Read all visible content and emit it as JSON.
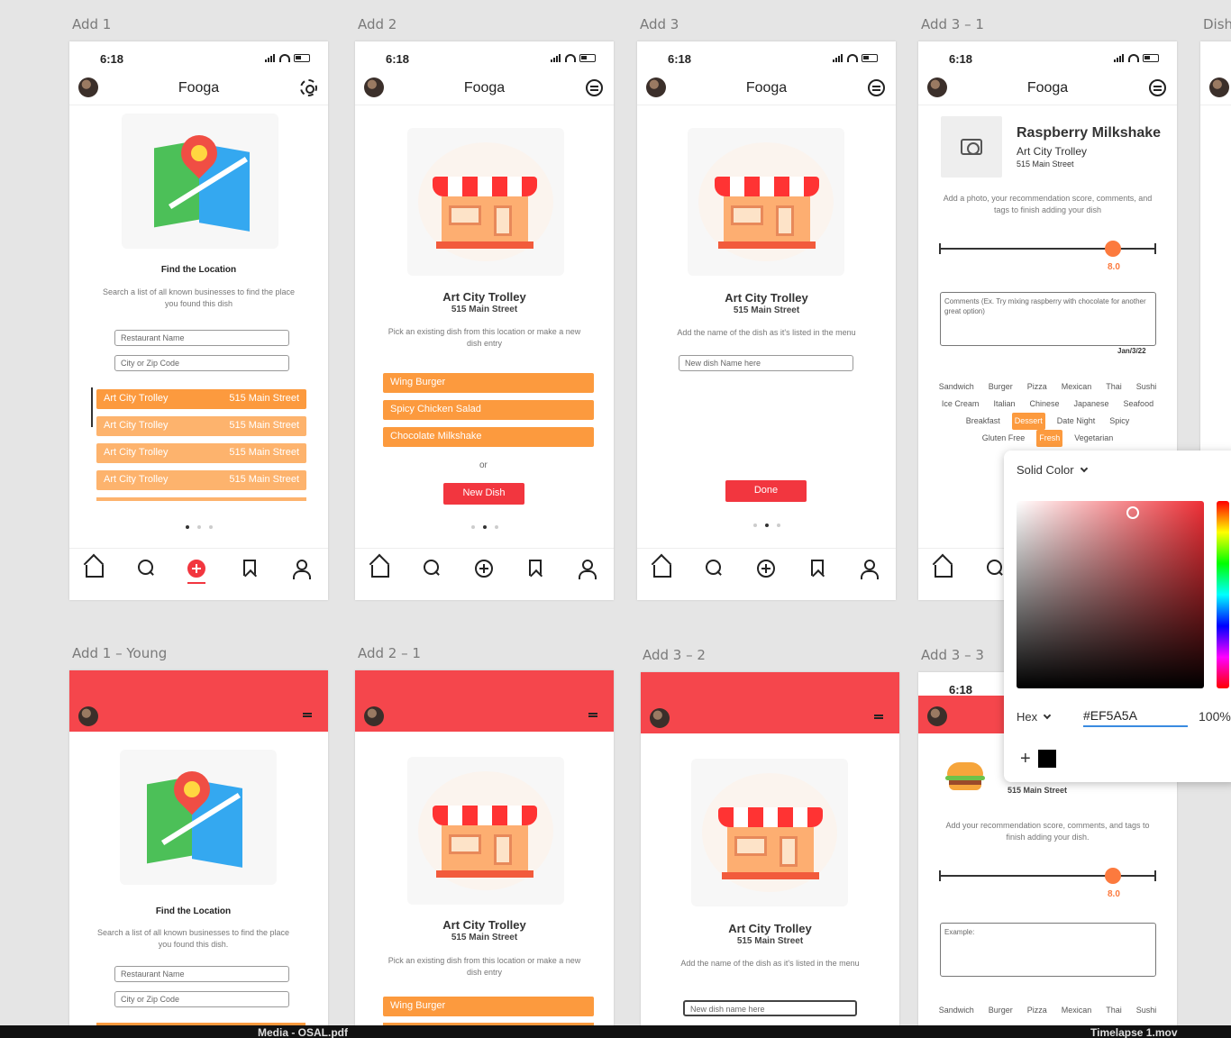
{
  "frames": {
    "add1": "Add 1",
    "add2": "Add 2",
    "add3": "Add 3",
    "add3_1": "Add 3 – 1",
    "dish": "Dish",
    "add1_young": "Add 1 – Young",
    "add2_1": "Add 2 – 1",
    "add3_2": "Add 3 – 2",
    "add3_3": "Add 3 – 3"
  },
  "status": {
    "time": "6:18"
  },
  "app": {
    "title": "Fooga"
  },
  "find_location": {
    "heading": "Find the Location",
    "subtitle": "Search a list of all known businesses to find the place you found this dish",
    "subtitle_young": "Search a list of all known businesses to find the place you found this dish.",
    "restaurant_placeholder": "Restaurant Name",
    "city_placeholder": "City or Zip Code",
    "results": [
      {
        "name": "Art City Trolley",
        "address": "515 Main Street"
      },
      {
        "name": "Art City Trolley",
        "address": "515 Main Street"
      },
      {
        "name": "Art City Trolley",
        "address": "515 Main Street"
      },
      {
        "name": "Art City Trolley",
        "address": "515 Main Street"
      }
    ]
  },
  "business": {
    "name": "Art City Trolley",
    "address": "515 Main Street"
  },
  "pick_dish": {
    "subtitle": "Pick an existing dish from this location or make a new dish entry",
    "dishes": [
      "Wing Burger",
      "Spicy Chicken Salad",
      "Chocolate Milkshake"
    ],
    "or": "or",
    "new_dish": "New Dish"
  },
  "add_name": {
    "subtitle": "Add the name of the dish as it's listed in the menu",
    "placeholder": "New dish Name here",
    "placeholder_alt": "New dish name here",
    "done": "Done"
  },
  "dish_detail": {
    "title": "Raspberry Milkshake",
    "place": "Art City Trolley",
    "address": "515 Main Street",
    "instructions": "Add a photo, your recommendation score, comments, and tags to finish adding your dish",
    "instructions_alt": "Add your recommendation score, comments, and tags to finish adding your dish.",
    "score": "8.0",
    "score_fraction": 0.8,
    "comment_placeholder": "Comments (Ex. Try mixing raspberry with chocolate for another great option)",
    "example_placeholder": "Example:",
    "date": "Jan/3/22",
    "tag_rows": [
      [
        "Sandwich",
        "Burger",
        "Pizza",
        "Mexican",
        "Thai",
        "Sushi"
      ],
      [
        "Ice Cream",
        "Italian",
        "Chinese",
        "Japanese",
        "Seafood"
      ],
      [
        "Breakfast",
        "Dessert",
        "Date Night",
        "Spicy"
      ],
      [
        "Gluten Free",
        "Fresh",
        "Vegetarian"
      ]
    ],
    "selected_tags": [
      "Dessert",
      "Fresh"
    ]
  },
  "color_picker": {
    "mode": "Solid Color",
    "hex_label": "Hex",
    "hex_value": "#EF5A5A",
    "alpha": "100%",
    "add": "+"
  },
  "taskbar": {
    "left": "Media - OSAL.pdf",
    "right": "Timelapse 1.mov"
  },
  "colors": {
    "accent_red": "#f2363f",
    "orange": "#fc9a3e",
    "young_header": "#f5464c"
  }
}
